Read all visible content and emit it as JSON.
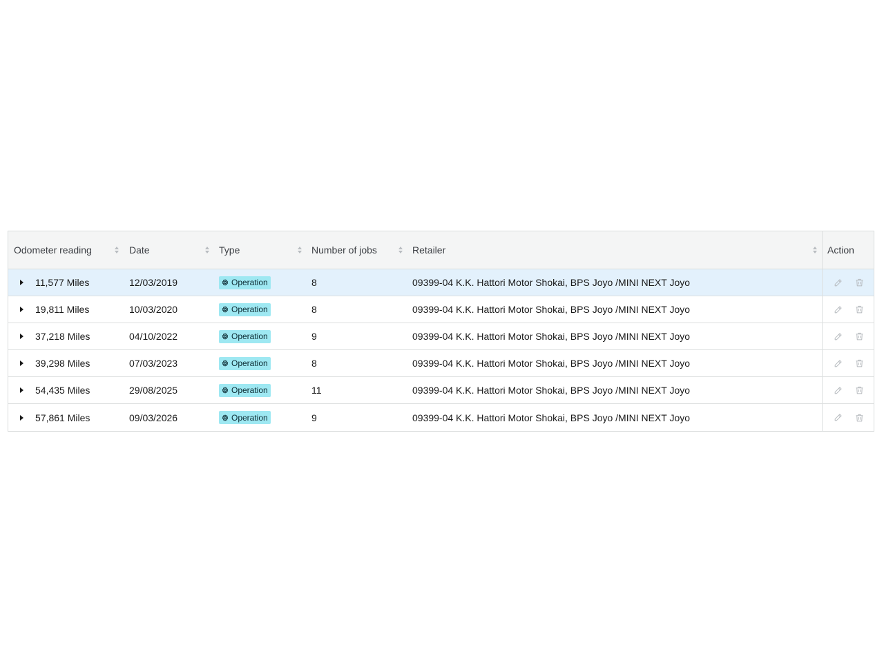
{
  "table": {
    "headers": {
      "odometer": "Odometer reading",
      "date": "Date",
      "type": "Type",
      "jobs": "Number of jobs",
      "retailer": "Retailer",
      "action": "Action"
    },
    "rows": [
      {
        "odometer": "11,577 Miles",
        "date": "12/03/2019",
        "type": "Operation",
        "jobs": "8",
        "retailer": "09399-04 K.K. Hattori Motor Shokai, BPS Joyo /MINI NEXT Joyo"
      },
      {
        "odometer": "19,811 Miles",
        "date": "10/03/2020",
        "type": "Operation",
        "jobs": "8",
        "retailer": "09399-04 K.K. Hattori Motor Shokai, BPS Joyo /MINI NEXT Joyo"
      },
      {
        "odometer": "37,218 Miles",
        "date": "04/10/2022",
        "type": "Operation",
        "jobs": "9",
        "retailer": "09399-04 K.K. Hattori Motor Shokai, BPS Joyo /MINI NEXT Joyo"
      },
      {
        "odometer": "39,298 Miles",
        "date": "07/03/2023",
        "type": "Operation",
        "jobs": "8",
        "retailer": "09399-04 K.K. Hattori Motor Shokai, BPS Joyo /MINI NEXT Joyo"
      },
      {
        "odometer": "54,435 Miles",
        "date": "29/08/2025",
        "type": "Operation",
        "jobs": "11",
        "retailer": "09399-04 K.K. Hattori Motor Shokai, BPS Joyo /MINI NEXT Joyo"
      },
      {
        "odometer": "57,861 Miles",
        "date": "09/03/2026",
        "type": "Operation",
        "jobs": "9",
        "retailer": "09399-04 K.K. Hattori Motor Shokai, BPS Joyo /MINI NEXT Joyo"
      }
    ],
    "selected_row": 0,
    "icons": {
      "expand": "caret-right-icon",
      "type_tag": "gear-icon",
      "edit": "pencil-icon",
      "delete": "trash-icon",
      "sort": "sort-icon"
    },
    "colors": {
      "header_bg": "#f4f5f5",
      "selected_row_bg": "#e3f1fc",
      "tag_bg": "#9ee8f2",
      "action_icon": "#b5b9bd"
    }
  }
}
